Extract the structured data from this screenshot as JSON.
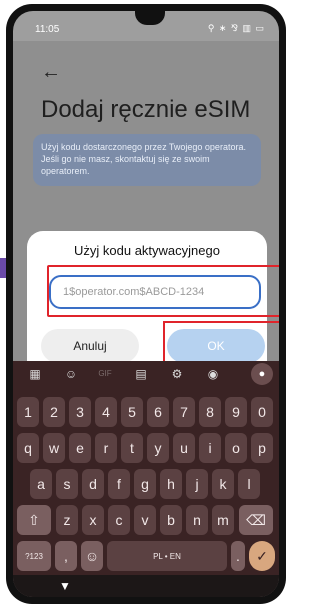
{
  "status": {
    "time": "11:05",
    "icons": "⚲ ∗ ⅋ ▥ ▭"
  },
  "header": {
    "back_icon": "←",
    "title": "Dodaj ręcznie eSIM"
  },
  "info_text": "Użyj kodu dostarczonego przez Twojego operatora. Jeśli go nie masz, skontaktuj się ze swoim operatorem.",
  "dialog": {
    "title": "Użyj kodu aktywacyjnego",
    "input_value": "1$operator.com$ABCD-1234",
    "cancel_label": "Anuluj",
    "ok_label": "OK"
  },
  "keyboard": {
    "toolbar": {
      "gif": "GIF"
    },
    "row_numbers": [
      "1",
      "2",
      "3",
      "4",
      "5",
      "6",
      "7",
      "8",
      "9",
      "0"
    ],
    "row_q": [
      "q",
      "w",
      "e",
      "r",
      "t",
      "y",
      "u",
      "i",
      "o",
      "p"
    ],
    "row_a": [
      "a",
      "s",
      "d",
      "f",
      "g",
      "h",
      "j",
      "k",
      "l"
    ],
    "row_z": [
      "z",
      "x",
      "c",
      "v",
      "b",
      "n",
      "m"
    ],
    "symbols_label": "?123",
    "comma": ",",
    "space_label": "PL • EN",
    "period": "."
  },
  "colors": {
    "highlight": "#e0242b",
    "input_border": "#3a6fc6",
    "ok_bg": "#b6d2f0",
    "keyboard_bg": "#3a2324"
  }
}
